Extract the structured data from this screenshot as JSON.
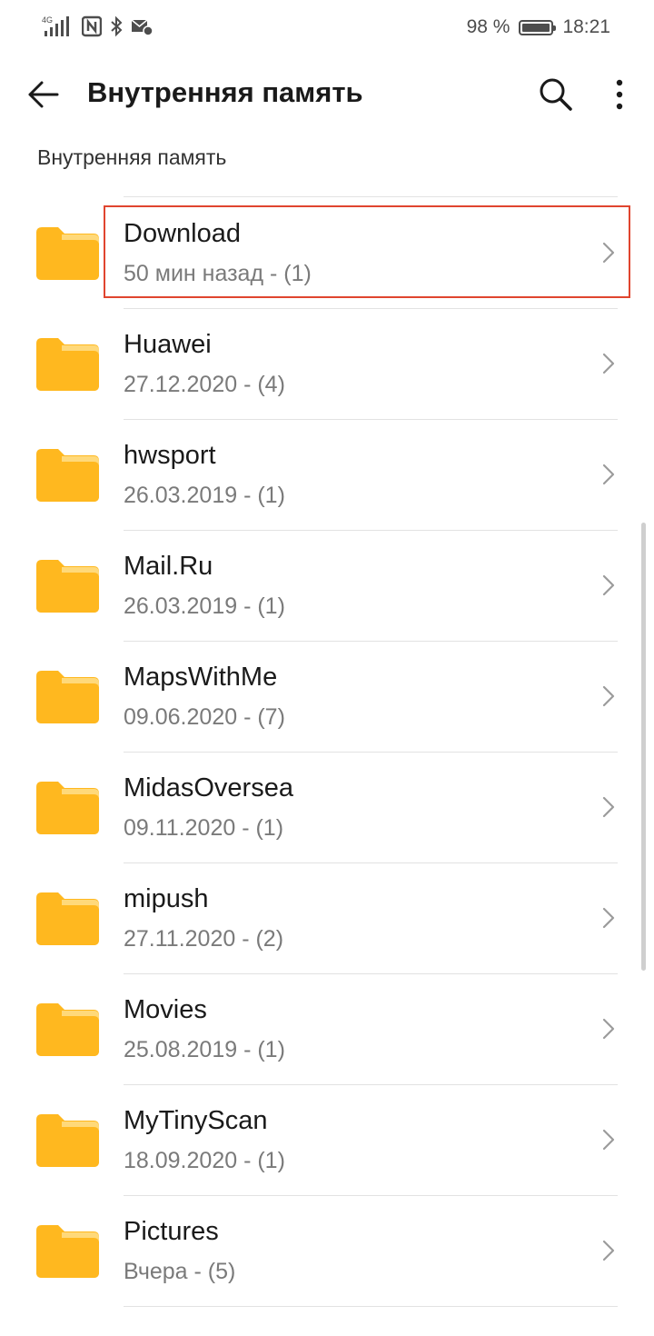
{
  "status_bar": {
    "network": "4G",
    "battery_percent": "98 %",
    "battery_level": 0.98,
    "time": "18:21",
    "icons": [
      "signal-icon",
      "nfc-icon",
      "bluetooth-icon",
      "mail-alert-icon",
      "battery-icon"
    ]
  },
  "app_bar": {
    "title": "Внутренняя память",
    "back_icon": "back-arrow-icon",
    "search_icon": "search-icon",
    "more_icon": "more-vert-icon"
  },
  "breadcrumb": "Внутренняя память",
  "colors": {
    "folder": "#FFB81F",
    "folder_tab": "#FFD97A",
    "highlight": "#E0452F"
  },
  "folders": [
    {
      "name": "Download",
      "meta": "50 мин назад - (1)",
      "highlighted": true
    },
    {
      "name": "Huawei",
      "meta": "27.12.2020 - (4)"
    },
    {
      "name": "hwsport",
      "meta": "26.03.2019 - (1)"
    },
    {
      "name": "Mail.Ru",
      "meta": "26.03.2019 - (1)"
    },
    {
      "name": "MapsWithMe",
      "meta": "09.06.2020 - (7)"
    },
    {
      "name": "MidasOversea",
      "meta": "09.11.2020 - (1)"
    },
    {
      "name": "mipush",
      "meta": "27.11.2020 - (2)"
    },
    {
      "name": "Movies",
      "meta": "25.08.2019 - (1)"
    },
    {
      "name": "MyTinyScan",
      "meta": "18.09.2020 - (1)"
    },
    {
      "name": "Pictures",
      "meta": "Вчера - (5)"
    }
  ]
}
